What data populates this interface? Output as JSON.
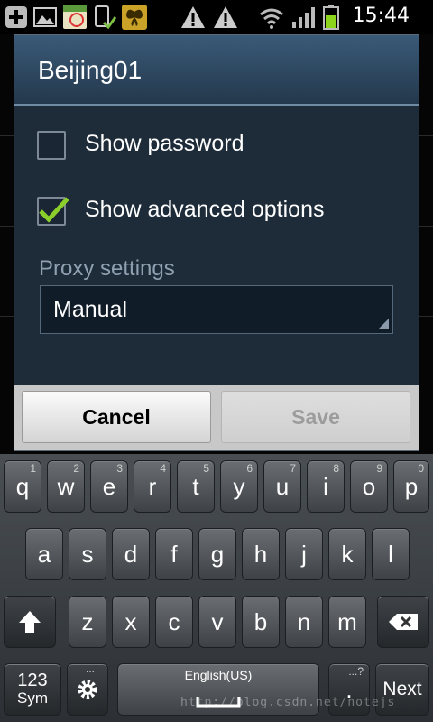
{
  "status_bar": {
    "time": "15:44",
    "left_icons": [
      "add-icon",
      "image-icon",
      "calendar-icon",
      "phone-check-icon",
      "butterfly-icon",
      "warning-icon",
      "warning-icon"
    ],
    "right_icons": [
      "wifi-icon",
      "signal-icon",
      "battery-icon"
    ]
  },
  "dialog": {
    "title": "Beijing01",
    "show_password": {
      "label": "Show password",
      "checked": false
    },
    "show_advanced": {
      "label": "Show advanced options",
      "checked": true
    },
    "proxy_label": "Proxy settings",
    "proxy_value": "Manual",
    "cancel_label": "Cancel",
    "save_label": "Save"
  },
  "keyboard": {
    "row1": [
      {
        "k": "q",
        "n": "1"
      },
      {
        "k": "w",
        "n": "2"
      },
      {
        "k": "e",
        "n": "3"
      },
      {
        "k": "r",
        "n": "4"
      },
      {
        "k": "t",
        "n": "5"
      },
      {
        "k": "y",
        "n": "6"
      },
      {
        "k": "u",
        "n": "7"
      },
      {
        "k": "i",
        "n": "8"
      },
      {
        "k": "o",
        "n": "9"
      },
      {
        "k": "p",
        "n": "0"
      }
    ],
    "row2": [
      "a",
      "s",
      "d",
      "f",
      "g",
      "h",
      "j",
      "k",
      "l"
    ],
    "row3": [
      "z",
      "x",
      "c",
      "v",
      "b",
      "n",
      "m"
    ],
    "sym_top": "123",
    "sym_bottom": "Sym",
    "language": "English(US)",
    "period": ".",
    "period_hint": "...?",
    "next_label": "Next",
    "settings_hint": "..."
  },
  "watermark": "http://blog.csdn.net/notejs"
}
